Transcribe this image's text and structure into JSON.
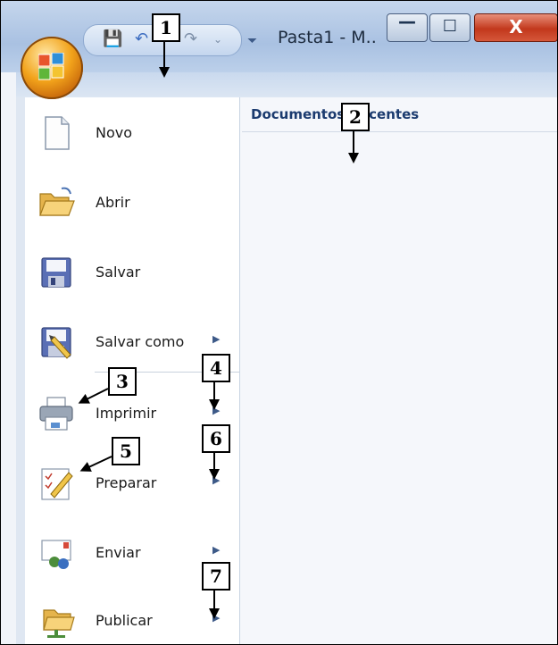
{
  "window": {
    "title": "Pasta1 - M..",
    "min_glyph": "—",
    "max_glyph": "☐",
    "close_glyph": "X"
  },
  "quick_access": [
    "save-icon",
    "undo-icon",
    "redo-icon",
    "customize-icon"
  ],
  "recent": {
    "title": "Documentos Recentes"
  },
  "menu": {
    "items": [
      {
        "label": "Novo",
        "icon": "new-document-icon",
        "submenu": false
      },
      {
        "label": "Abrir",
        "icon": "open-folder-icon",
        "submenu": false
      },
      {
        "label": "Salvar",
        "icon": "save-icon",
        "submenu": false
      },
      {
        "label": "Salvar como",
        "icon": "save-as-icon",
        "submenu": true
      },
      {
        "label": "Imprimir",
        "icon": "printer-icon",
        "submenu": true
      },
      {
        "label": "Preparar",
        "icon": "prepare-icon",
        "submenu": true
      },
      {
        "label": "Enviar",
        "icon": "send-icon",
        "submenu": true
      },
      {
        "label": "Publicar",
        "icon": "publish-icon",
        "submenu": true
      }
    ]
  },
  "callouts": [
    "1",
    "2",
    "3",
    "4",
    "5",
    "6",
    "7"
  ],
  "colors": {
    "accent": "#1b3b6f",
    "orb": "#f2a31b",
    "close": "#c2381c"
  }
}
